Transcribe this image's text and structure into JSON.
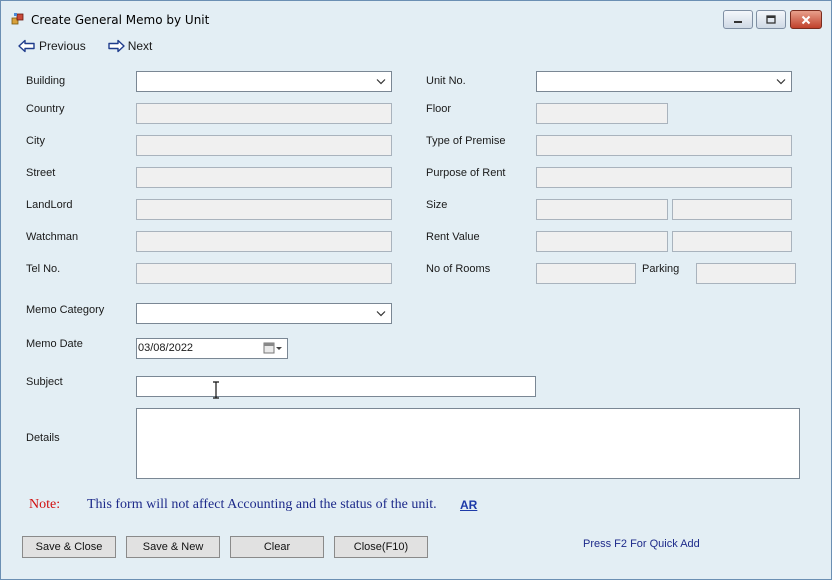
{
  "window": {
    "title": "Create General Memo by Unit"
  },
  "nav": {
    "previous_label": "Previous",
    "next_label": "Next"
  },
  "labels": {
    "building": "Building",
    "country": "Country",
    "city": "City",
    "street": "Street",
    "landlord": "LandLord",
    "watchman": "Watchman",
    "tel_no": "Tel No.",
    "unit_no": "Unit No.",
    "floor": "Floor",
    "type_of_premise": "Type of Premise",
    "purpose_of_rent": "Purpose of Rent",
    "size": "Size",
    "rent_value": "Rent Value",
    "no_of_rooms": "No of Rooms",
    "parking": "Parking",
    "memo_category": "Memo Category",
    "memo_date": "Memo Date",
    "subject": "Subject",
    "details": "Details"
  },
  "values": {
    "memo_date": "03/08/2022"
  },
  "note": {
    "label": "Note:",
    "text": "This form will not affect Accounting and the status of the unit.",
    "link": "AR"
  },
  "buttons": {
    "save_close": "Save & Close",
    "save_new": "Save & New",
    "clear": "Clear",
    "close": "Close(F10)"
  },
  "hint": "Press F2 For Quick Add",
  "colors": {
    "window_bg": "#e3eef4",
    "note_red": "#d11010",
    "note_blue": "#1d2a8a"
  }
}
